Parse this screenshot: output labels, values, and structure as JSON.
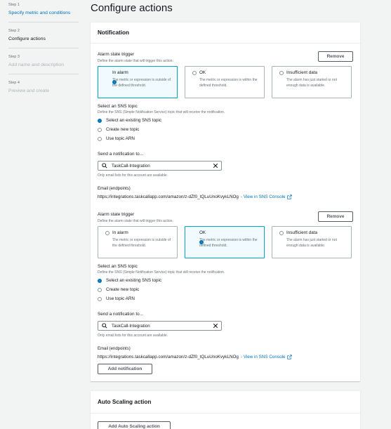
{
  "wizard": {
    "steps": [
      {
        "num": "Step 1",
        "title": "Specify metric and conditions"
      },
      {
        "num": "Step 2",
        "title": "Configure actions"
      },
      {
        "num": "Step 3",
        "title": "Add name and description"
      },
      {
        "num": "Step 4",
        "title": "Preview and create"
      }
    ]
  },
  "page": {
    "title": "Configure actions"
  },
  "notification": {
    "header": "Notification",
    "add_notification_label": "Add notification",
    "blocks": [
      {
        "trigger_label": "Alarm state trigger",
        "trigger_desc": "Define the alarm state that will trigger this action.",
        "remove_label": "Remove",
        "states": [
          {
            "label": "In alarm",
            "desc": "The metric or expression is outside of the defined threshold."
          },
          {
            "label": "OK",
            "desc": "The metric or expression is within the defined threshold."
          },
          {
            "label": "Insufficient data",
            "desc": "The alarm has just started or not enough data is available."
          }
        ],
        "selected_state": "In alarm",
        "sns_label": "Select an SNS topic",
        "sns_desc": "Define the SNS (Simple Notification Service) topic that will receive the notification.",
        "sns_options": [
          "Select an existing SNS topic",
          "Create new topic",
          "Use topic ARN"
        ],
        "send_label": "Send a notification to...",
        "send_value": "TaskCall-Integration",
        "send_hint": "Only email lists for this account are available.",
        "email_label": "Email (endpoints)",
        "email_value": "https://integrations.taskcallapp.com/amazon/z-dZf0_tQLuUnoKvykLNOg",
        "email_link": "- View in SNS Console"
      },
      {
        "trigger_label": "Alarm state trigger",
        "trigger_desc": "Define the alarm state that will trigger this action.",
        "remove_label": "Remove",
        "states": [
          {
            "label": "In alarm",
            "desc": "The metric or expression is outside of the defined threshold."
          },
          {
            "label": "OK",
            "desc": "The metric or expression is within the defined threshold."
          },
          {
            "label": "Insufficient data",
            "desc": "The alarm has just started or not enough data is available."
          }
        ],
        "selected_state": "OK",
        "sns_label": "Select an SNS topic",
        "sns_desc": "Define the SNS (Simple Notification Service) topic that will receive the notification.",
        "sns_options": [
          "Select an existing SNS topic",
          "Create new topic",
          "Use topic ARN"
        ],
        "send_label": "Send a notification to...",
        "send_value": "TaskCall-Integration",
        "send_hint": "Only email lists for this account are available.",
        "email_label": "Email (endpoints)",
        "email_value": "https://integrations.taskcallapp.com/amazon/z-dZf0_tQLuUnoKvykLNOg",
        "email_link": "- View in SNS Console"
      }
    ]
  },
  "autoscaling": {
    "header": "Auto Scaling action",
    "add_label": "Add Auto Scaling action"
  },
  "colors": {
    "link": "#0073bb",
    "selected_border": "#00a1c9",
    "selected_bg": "#f1faff"
  },
  "icons": {
    "search": "search-icon",
    "clear": "close-icon",
    "external": "external-link-icon"
  }
}
